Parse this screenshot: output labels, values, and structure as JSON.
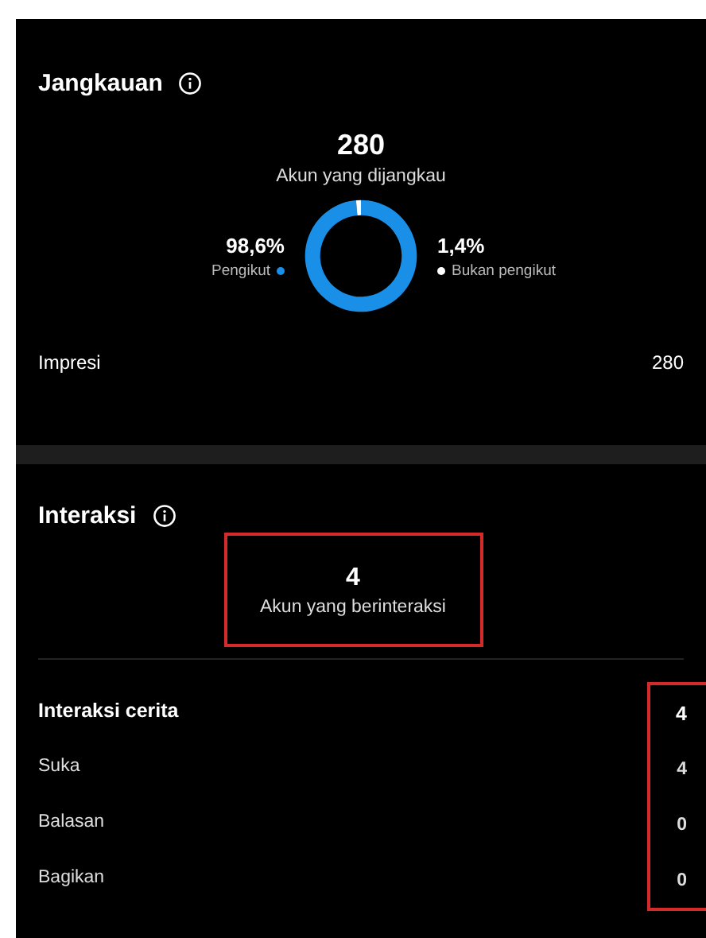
{
  "reach": {
    "title": "Jangkauan",
    "total": "280",
    "total_label": "Akun yang dijangkau",
    "chart_data": {
      "type": "donut",
      "categories": [
        "Pengikut",
        "Bukan pengikut"
      ],
      "values": [
        98.6,
        1.4
      ],
      "colors": [
        "#1a8fe8",
        "#ffffff"
      ],
      "value_labels": [
        "98,6%",
        "1,4%"
      ]
    },
    "stats": [
      {
        "label": "Impresi",
        "value": "280"
      }
    ]
  },
  "interactions": {
    "title": "Interaksi",
    "total": "4",
    "total_label": "Akun yang berinteraksi",
    "total_highlighted": true,
    "values_highlighted": true,
    "rows": [
      {
        "label": "Interaksi cerita",
        "value": "4",
        "kind": "header"
      },
      {
        "label": "Suka",
        "value": "4",
        "kind": "item"
      },
      {
        "label": "Balasan",
        "value": "0",
        "kind": "item"
      },
      {
        "label": "Bagikan",
        "value": "0",
        "kind": "item"
      }
    ]
  }
}
